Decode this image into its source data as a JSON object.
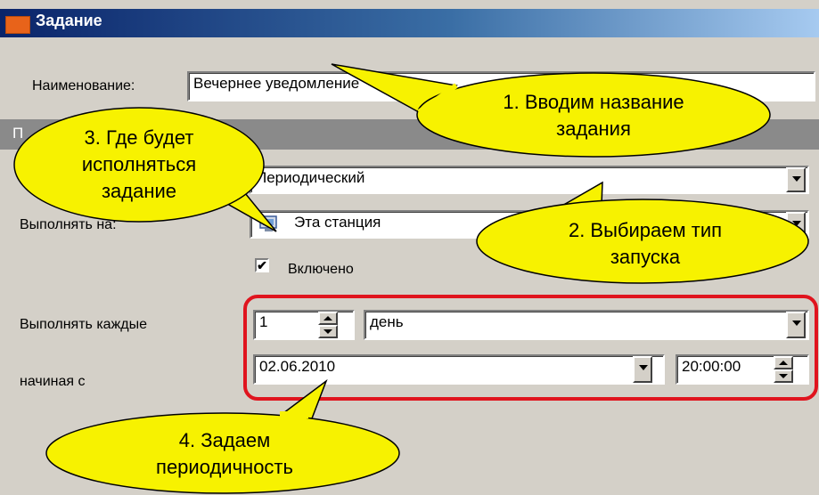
{
  "window": {
    "title": "Задание"
  },
  "form": {
    "name_label": "Наименование:",
    "name_value": "Вечернее уведомление",
    "section_label": "П",
    "type_value": "Периодический",
    "run_on_label": "Выполнять на:",
    "run_on_value": "Эта станция",
    "enabled_label": "Включено",
    "enabled_checked": true,
    "every_label": "Выполнять каждые",
    "every_count": "1",
    "every_unit": "день",
    "start_label": "начиная с",
    "start_date": "02.06.2010",
    "start_time": "20:00:00"
  },
  "callouts": {
    "c1_line1": "1. Вводим название",
    "c1_line2": "задания",
    "c2_line1": "2. Выбираем тип",
    "c2_line2": "запуска",
    "c3_line1": "3. Где будет",
    "c3_line2": "исполняться",
    "c3_line3": "задание",
    "c4_line1": "4. Задаем",
    "c4_line2": "периодичность"
  },
  "colors": {
    "callout_fill": "#f7f200",
    "highlight": "#e0141e",
    "titlebar": "#0a246a"
  },
  "icons": {
    "station": "computer-icon",
    "checkbox": "checkmark-icon"
  }
}
